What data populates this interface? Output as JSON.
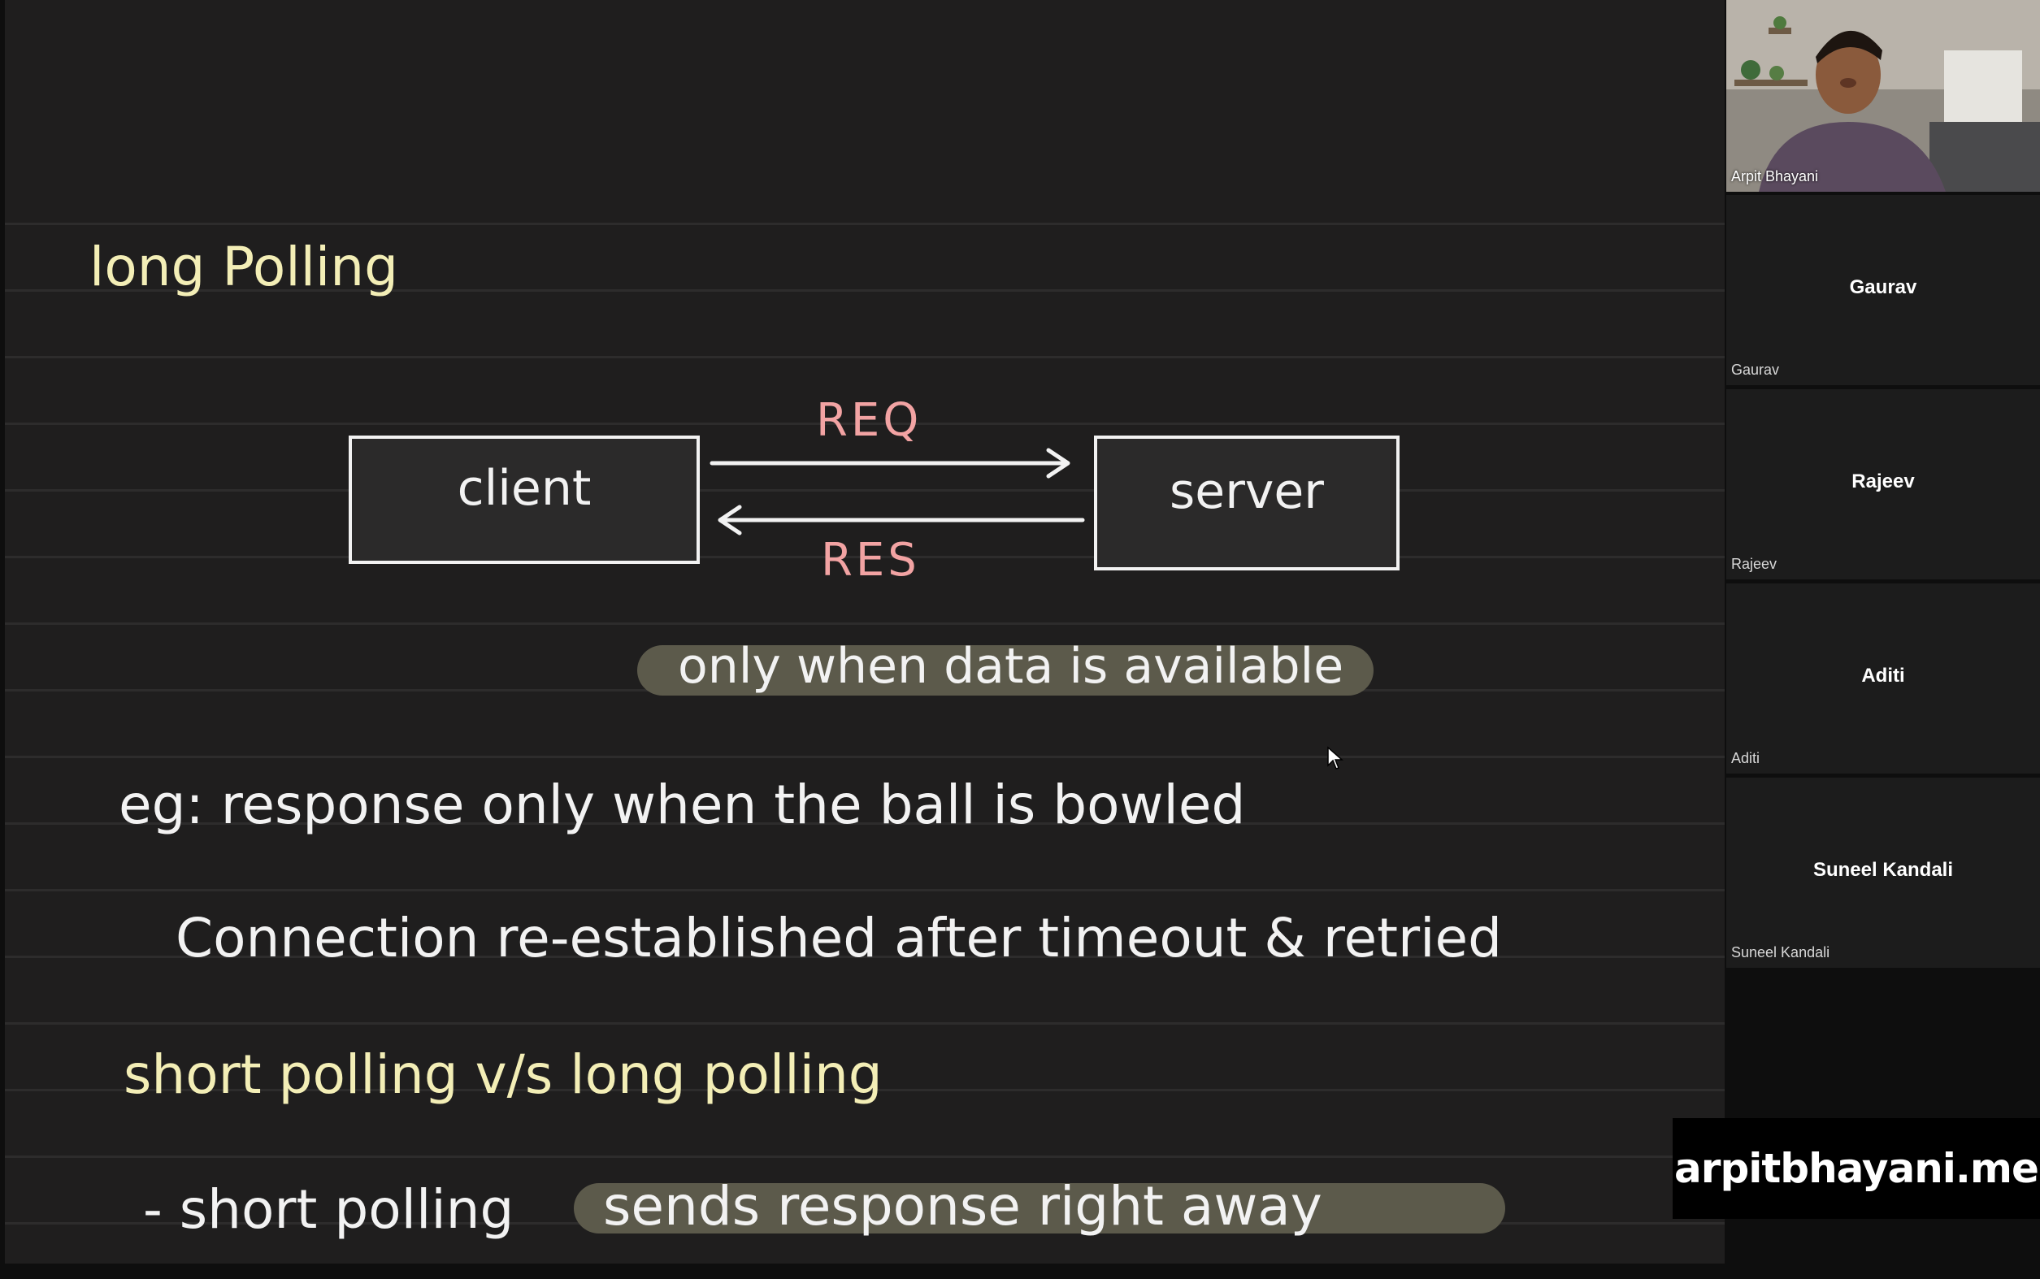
{
  "board": {
    "title": "long Polling",
    "diagram": {
      "client_label": "client",
      "server_label": "server",
      "req_label": "REQ",
      "res_label": "RES",
      "highlight_note": "only when data is available"
    },
    "lines": {
      "example": "eg: response only when the ball is bowled",
      "connection": "Connection re-established after timeout & retried",
      "comparison": "short polling v/s long polling",
      "short_prefix": "- short polling",
      "short_highlight": "sends response right away"
    }
  },
  "participants": {
    "host": {
      "name": "Arpit Bhayani"
    },
    "tiles": [
      {
        "center_name": "Gaurav",
        "corner_name": "Gaurav"
      },
      {
        "center_name": "Rajeev",
        "corner_name": "Rajeev"
      },
      {
        "center_name": "Aditi",
        "corner_name": "Aditi"
      },
      {
        "center_name": "Suneel Kandali",
        "corner_name": "Suneel Kandali"
      }
    ]
  },
  "watermark": "arpitbhayani.me",
  "colors": {
    "board_bg": "#1f1e1e",
    "ink_white": "#f2f2f2",
    "ink_yellow": "#f3eeb6",
    "ink_pink": "#f2a3a3",
    "highlight_bg": "#5c5a4b",
    "tile_bg": "#1c1c1c"
  }
}
